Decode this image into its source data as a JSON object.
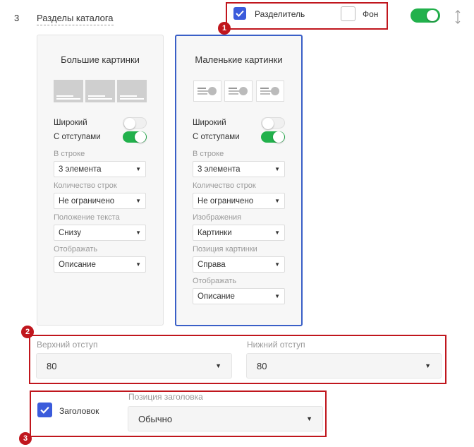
{
  "section": {
    "number": "3",
    "title": "Разделы каталога"
  },
  "top": {
    "divider_label": "Разделитель",
    "divider_checked": true,
    "background_label": "Фон",
    "background_checked": false,
    "enabled": true
  },
  "cards": [
    {
      "title": "Большие картинки",
      "wide_label": "Широкий",
      "wide_on": false,
      "padding_label": "С отступами",
      "padding_on": true,
      "fields": [
        {
          "label": "В строке",
          "value": "3 элемента"
        },
        {
          "label": "Количество строк",
          "value": "Не ограничено"
        },
        {
          "label": "Положение текста",
          "value": "Снизу"
        },
        {
          "label": "Отображать",
          "value": "Описание"
        }
      ]
    },
    {
      "title": "Маленькие картинки",
      "wide_label": "Широкий",
      "wide_on": false,
      "padding_label": "С отступами",
      "padding_on": true,
      "fields": [
        {
          "label": "В строке",
          "value": "3 элемента"
        },
        {
          "label": "Количество строк",
          "value": "Не ограничено"
        },
        {
          "label": "Изображения",
          "value": "Картинки"
        },
        {
          "label": "Позиция картинки",
          "value": "Справа"
        },
        {
          "label": "Отображать",
          "value": "Описание"
        }
      ]
    }
  ],
  "padding": {
    "top_label": "Верхний отступ",
    "top_value": "80",
    "bottom_label": "Нижний отступ",
    "bottom_value": "80"
  },
  "header": {
    "label": "Заголовок",
    "checked": true,
    "position_label": "Позиция заголовка",
    "position_value": "Обычно"
  },
  "badges": [
    "1",
    "2",
    "3"
  ],
  "icons": {
    "check": "check-icon",
    "arrow": "chevron-down-icon",
    "resize": "vertical-resize-icon"
  },
  "colors": {
    "accent": "#3b5bdb",
    "toggle_on": "#22b14c",
    "annotation": "#c0161d",
    "active_card": "#3a5fc7"
  }
}
